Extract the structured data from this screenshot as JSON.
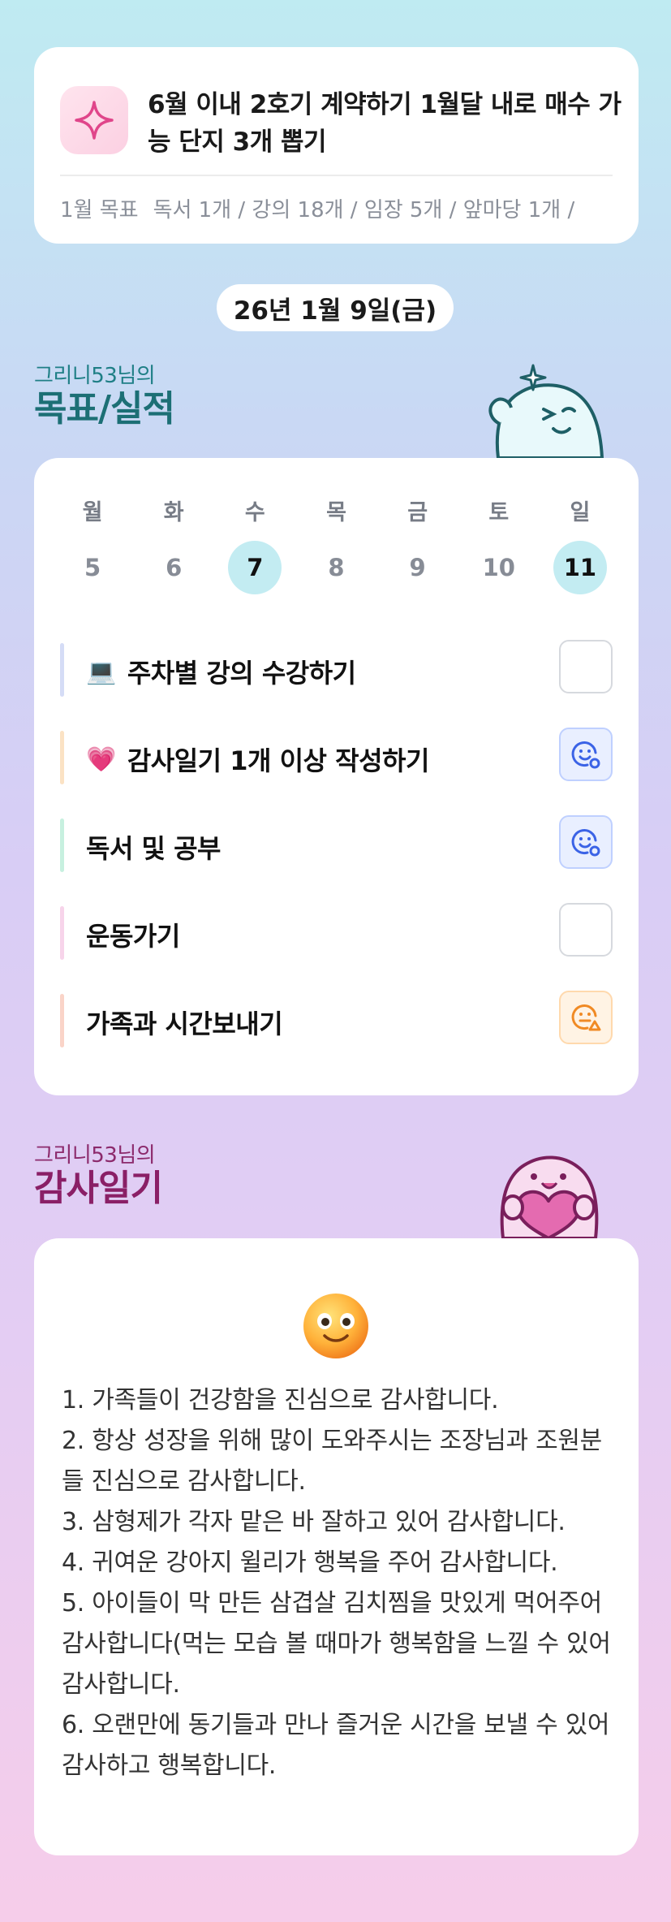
{
  "goal_card": {
    "title": "6월 이내 2호기 계약하기 1월달 내로 매수 가능 단지 3개 뽑기",
    "subtitle_label": "1월 목표",
    "subtitle_items": "독서 1개 / 강의 18개 / 임장 5개 / 앞마당 1개 /"
  },
  "date": "26년 1월 9일(금)",
  "goals_section": {
    "small_title": "그리니53님의",
    "big_title": "목표/실적"
  },
  "week": {
    "days": [
      {
        "name": "월",
        "num": "5"
      },
      {
        "name": "화",
        "num": "6"
      },
      {
        "name": "수",
        "num": "7"
      },
      {
        "name": "목",
        "num": "8"
      },
      {
        "name": "금",
        "num": "9"
      },
      {
        "name": "토",
        "num": "10"
      },
      {
        "name": "일",
        "num": "11"
      }
    ]
  },
  "tasks": [
    {
      "emoji": "💻",
      "label": "주차별 강의 수강하기",
      "bar_color": "#d5dcf6",
      "status": "empty"
    },
    {
      "emoji": "💗",
      "label": "감사일기 1개 이상 작성하기",
      "bar_color": "#fbe2c4",
      "status": "done-blue"
    },
    {
      "emoji": "",
      "label": "독서 및 공부",
      "bar_color": "#c7f0df",
      "status": "done-blue"
    },
    {
      "emoji": "",
      "label": "운동가기",
      "bar_color": "#f7d4ea",
      "status": "empty"
    },
    {
      "emoji": "",
      "label": "가족과 시간보내기",
      "bar_color": "#fad4c8",
      "status": "partial-orange"
    }
  ],
  "diary_section": {
    "small_title": "그리니53님의",
    "big_title": "감사일기"
  },
  "diary": {
    "lines": [
      "1. 가족들이 건강함을 진심으로 감사합니다.",
      "2. 항상 성장을 위해 많이 도와주시는 조장님과 조원분들 진심으로 감사합니다.",
      "3. 삼형제가 각자 맡은 바 잘하고 있어 감사합니다.",
      "4. 귀여운 강아지 윌리가 행복을 주어 감사합니다.",
      "5. 아이들이 막 만든 삼겹살 김치찜을 맛있게 먹어주어 감사합니다(먹는 모습 볼 때마가 행복함을 느낄 수 있어 감사합니다.",
      "6. 오랜만에 동기들과 만나 즐거운 시간을 보낼 수 있어 감사하고 행복합니다."
    ]
  },
  "colors": {
    "accent_teal": "#1c6f75",
    "accent_magenta": "#8a1f66",
    "active_day_bg": "#c3ecf2",
    "done_blue": "#3b63e6",
    "partial_orange": "#f08a24"
  }
}
